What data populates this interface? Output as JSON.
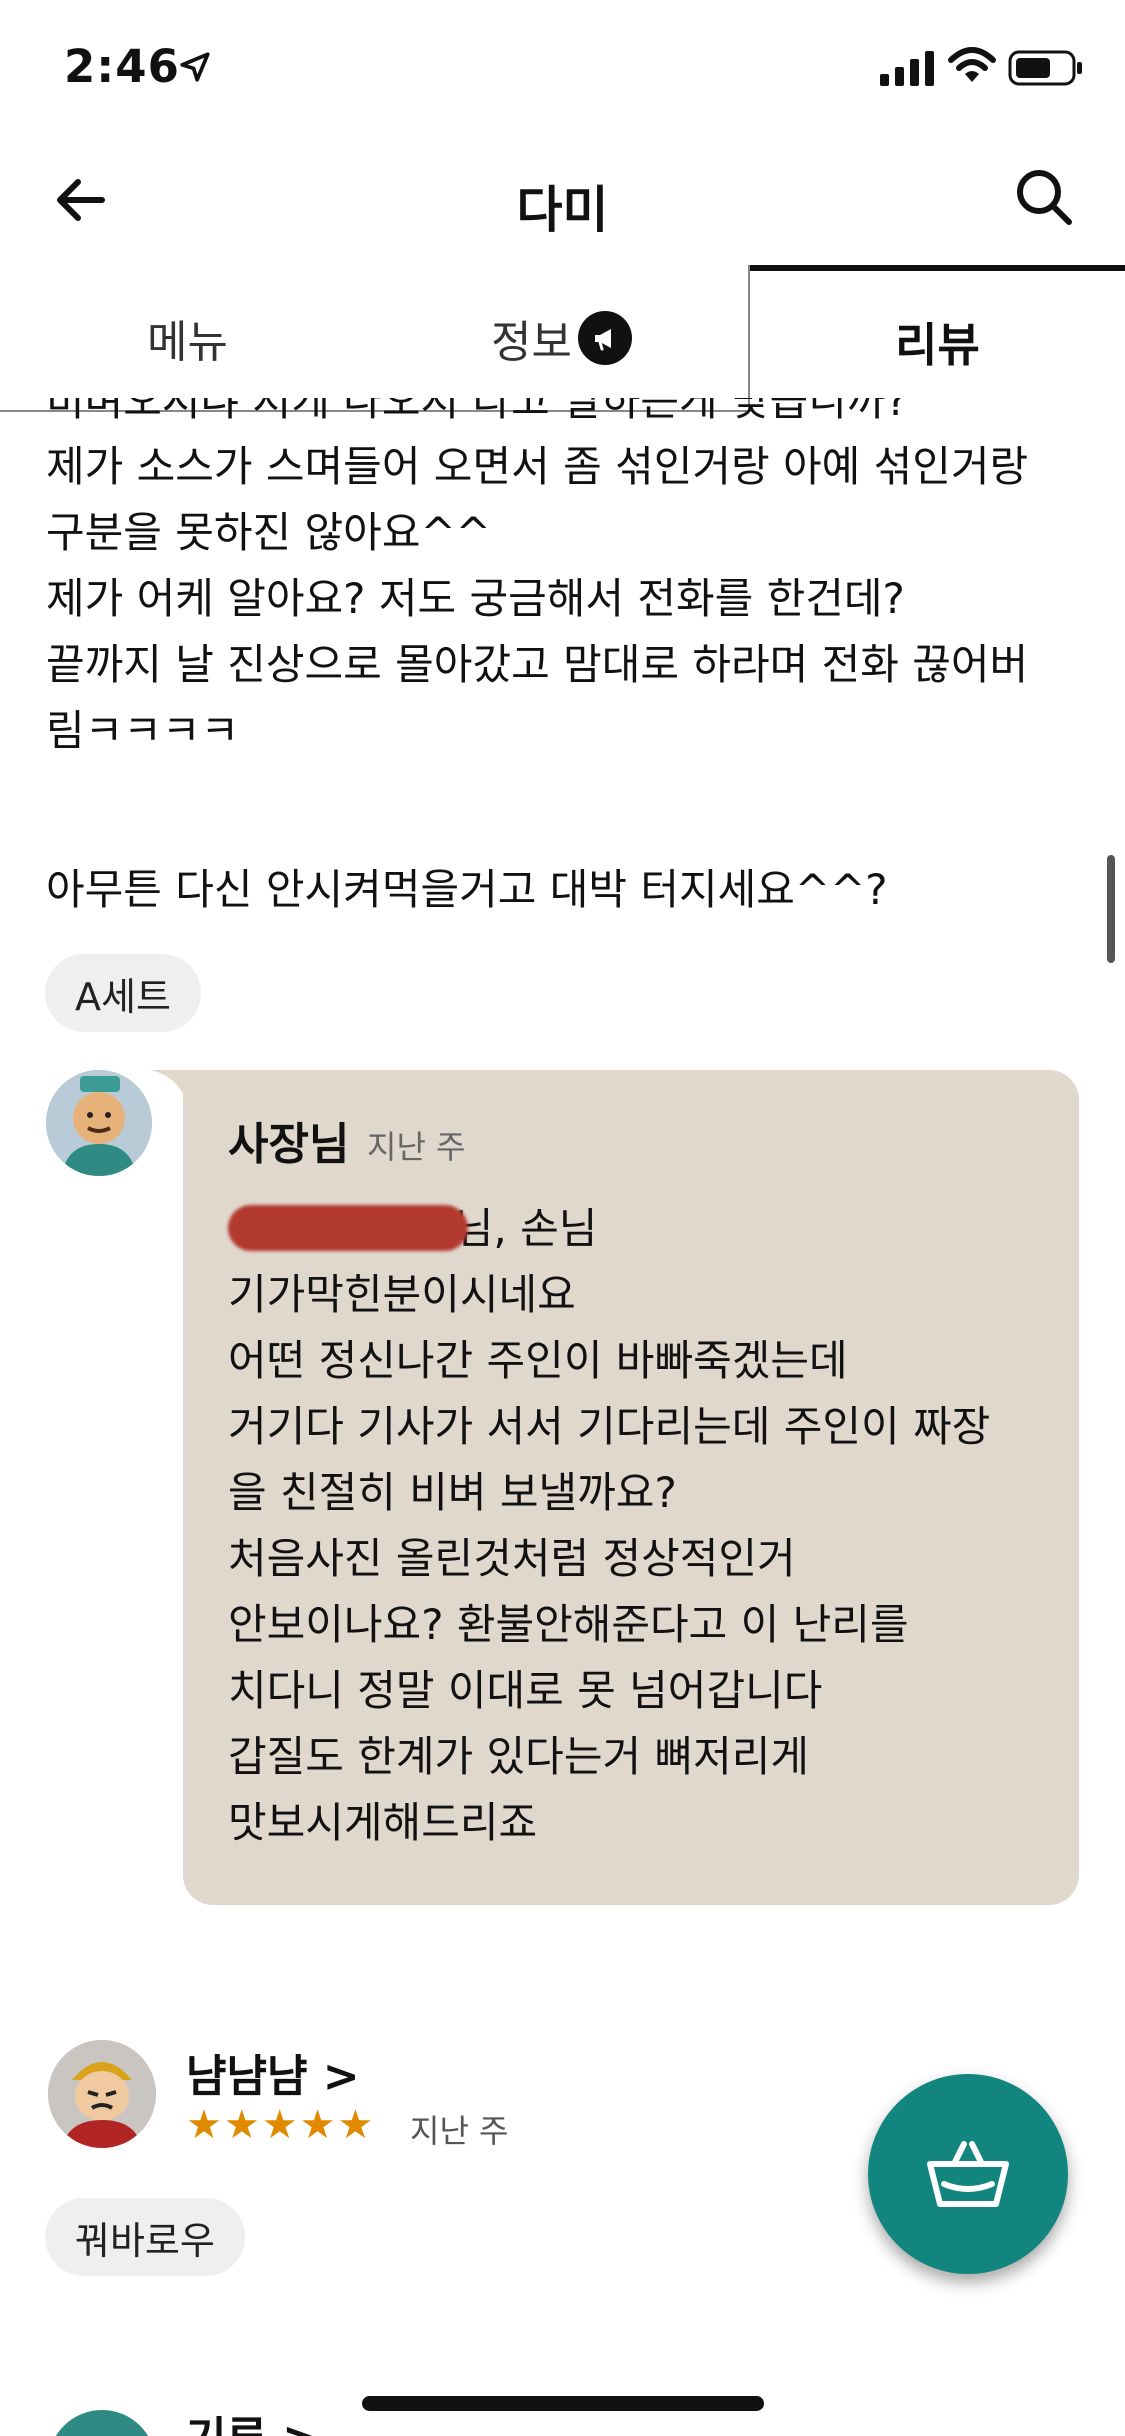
{
  "status_bar": {
    "time": "2:46"
  },
  "header": {
    "title": "다미"
  },
  "tabs": [
    {
      "label": "메뉴"
    },
    {
      "label": "정보"
    },
    {
      "label": "리뷰"
    }
  ],
  "review": {
    "lines": [
      "비벼오시냐 저케 나오지 라고 말하는게 맞습니까?",
      "제가 소스가 스며들어 오면서 좀 섞인거랑 아예 섞인거랑",
      "구분을 못하진 않아요^^",
      "제가 어케 알아요? 저도 궁금해서 전화를 한건데?",
      "끝까지 날 진상으로 몰아갔고 맘대로 하라며 전화 끊어버",
      "림ㅋㅋㅋㅋ"
    ],
    "last_line": "아무튼 다신 안시켜먹을거고  대박 터지세요^^?",
    "menu_chip": "A세트"
  },
  "owner_reply": {
    "name": "사장님",
    "time": "지난 주",
    "first_line_visible": "4님, 손님",
    "lines": [
      "기가막힌분이시네요",
      "어떤 정신나간 주인이 바빠죽겠는데",
      "거기다 기사가 서서 기다리는데 주인이 짜장",
      "을 친절히 비벼 보낼까요?",
      "처음사진 올린것처럼 정상적인거",
      "안보이나요? 환불안해준다고 이 난리를",
      "치다니 정말 이대로 못 넘어갑니다",
      "갑질도 한계가 있다는거 뼈저리게",
      "맛보시게해드리죠"
    ]
  },
  "review2": {
    "name": "냠냠냠 >",
    "rating": 5,
    "stars": "★★★★★",
    "time": "지난 주",
    "menu_chip": "꿔바로우"
  },
  "review3": {
    "name": "기루 >"
  },
  "colors": {
    "accent": "#12857f",
    "star": "#e08a00",
    "reply_bg": "#e0d7cd",
    "redaction": "#b33a2e"
  },
  "icons": {
    "back": "back-arrow-icon",
    "search": "search-icon",
    "info_badge": "megaphone-icon",
    "cart": "basket-icon"
  }
}
